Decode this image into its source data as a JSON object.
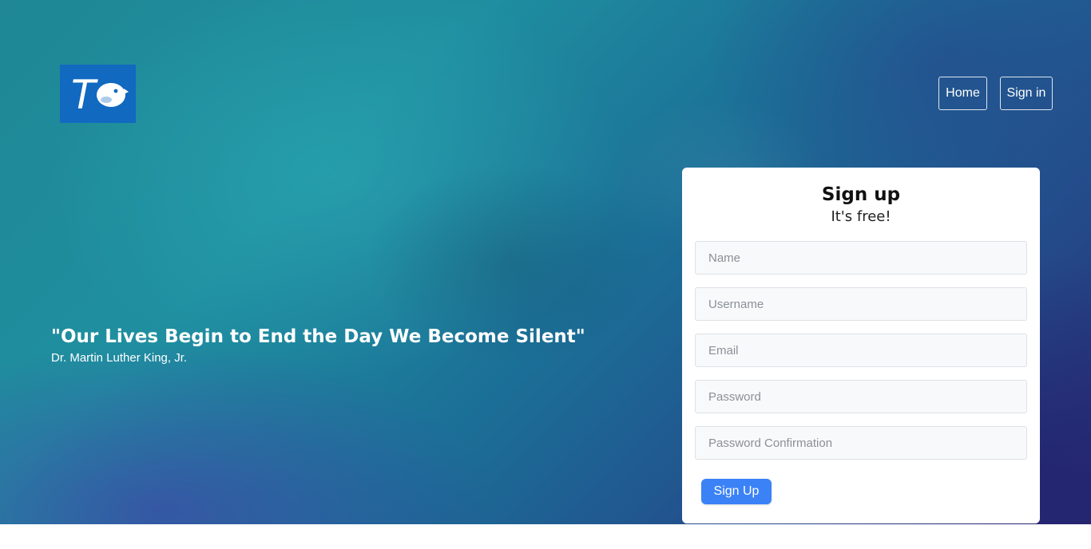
{
  "nav": {
    "home_label": "Home",
    "signin_label": "Sign in"
  },
  "logo": {
    "letter": "T",
    "icon": "bird-icon",
    "bg_color": "#1169c0"
  },
  "quote": {
    "text": "\"Our Lives Begin to End the Day We Become Silent\"",
    "author": "Dr. Martin Luther King, Jr."
  },
  "signup": {
    "title": "Sign up",
    "subtitle": "It's free!",
    "fields": {
      "name_placeholder": "Name",
      "username_placeholder": "Username",
      "email_placeholder": "Email",
      "password_placeholder": "Password",
      "password_confirmation_placeholder": "Password Confirmation"
    },
    "submit_label": "Sign Up",
    "submit_color": "#3b82f6"
  }
}
